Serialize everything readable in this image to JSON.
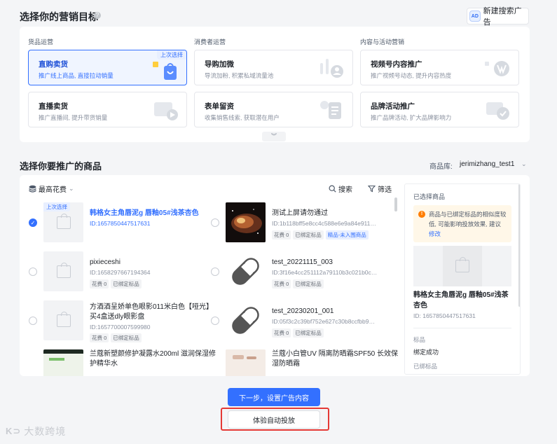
{
  "header": {
    "title": "选择你的营销目标",
    "help_icon": "?",
    "new_search_ad_label": "新建搜索广告",
    "ad_icon_text": "AD"
  },
  "goals": {
    "categories": [
      {
        "label": "货品运营",
        "cards": [
          {
            "title": "直购卖货",
            "desc": "推广线上商品, 直接拉动销量",
            "tag": "上次选择"
          },
          {
            "title": "直播卖货",
            "desc": "推广直播间, 提升带货销量"
          }
        ]
      },
      {
        "label": "消费者运营",
        "cards": [
          {
            "title": "导购加微",
            "desc": "导流加粉, 积累私域流量池"
          },
          {
            "title": "表单留资",
            "desc": "收集销售线索, 获取潜在用户"
          }
        ]
      },
      {
        "label": "内容与活动营销",
        "cards": [
          {
            "title": "视频号内容推广",
            "desc": "推广视频号动态, 提升内容热度"
          },
          {
            "title": "品牌活动推广",
            "desc": "推广品牌活动, 扩大品牌影响力"
          }
        ]
      }
    ],
    "expand_glyph": "︾"
  },
  "products": {
    "title": "选择你要推广的商品",
    "library_label": "商品库:",
    "library_value": "jerimizhang_test1",
    "sort_label": "最高花费",
    "search_label": "搜索",
    "filter_label": "筛选",
    "last_tag": "上次选择",
    "check_glyph": "✓",
    "items": [
      {
        "name": "韩格女主角唇泥g 唇釉05#浅茶杏色",
        "id": "ID:1657850447517631",
        "tags": []
      },
      {
        "name": "测试上屏请勿通过",
        "id": "ID:1b118bff5e8cc4c588e6e9a84e911…",
        "tags": [
          "花费 0",
          "已绑定标品",
          "精品-未入围商品"
        ]
      },
      {
        "name": "pixieceshi",
        "id": "ID:1658297667194364",
        "tags": [
          "花费 0",
          "已绑定标品"
        ]
      },
      {
        "name": "test_20221115_003",
        "id": "ID:3f16e4cc251112a79110b3c021b0c…",
        "tags": [
          "花费 0",
          "已绑定标品"
        ]
      },
      {
        "name": "方酒酒呈娇单色眼影011米白色【哑光】买4盒送dly眼影盘",
        "id": "ID:1657700007599980",
        "tags": [
          "花费 0",
          "已绑定标品"
        ]
      },
      {
        "name": "test_20230201_001",
        "id": "ID:05f3c2c39bf752e627c30b8ccfbb9…",
        "tags": [
          "花费 0",
          "已绑定标品"
        ]
      },
      {
        "name": "兰蔻新塑颜修护凝露水200ml 滋润保湿修护精华水",
        "id": "",
        "tags": []
      },
      {
        "name": "兰蔻小白管UV 隔离防晒霜SPF50 长效保湿防晒霜",
        "id": "",
        "tags": []
      }
    ]
  },
  "selected": {
    "head": "已选择商品",
    "warn_text": "商品与已绑定标品的相似度较低, 可能影响投放效果, 建议",
    "warn_link": "修改",
    "warn_icon": "!",
    "name": "韩格女主角唇泥g 唇釉05#浅茶杏色",
    "id": "ID: 1657850447517631",
    "kv": [
      {
        "label": "标品",
        "value": "绑定成功"
      },
      {
        "label": "已绑标品",
        "value": ""
      }
    ]
  },
  "actions": {
    "next_label": "下一步，设置广告内容",
    "auto_label": "体验自动投放"
  },
  "watermark": {
    "mark": "K⊃",
    "text": "大数跨境"
  }
}
